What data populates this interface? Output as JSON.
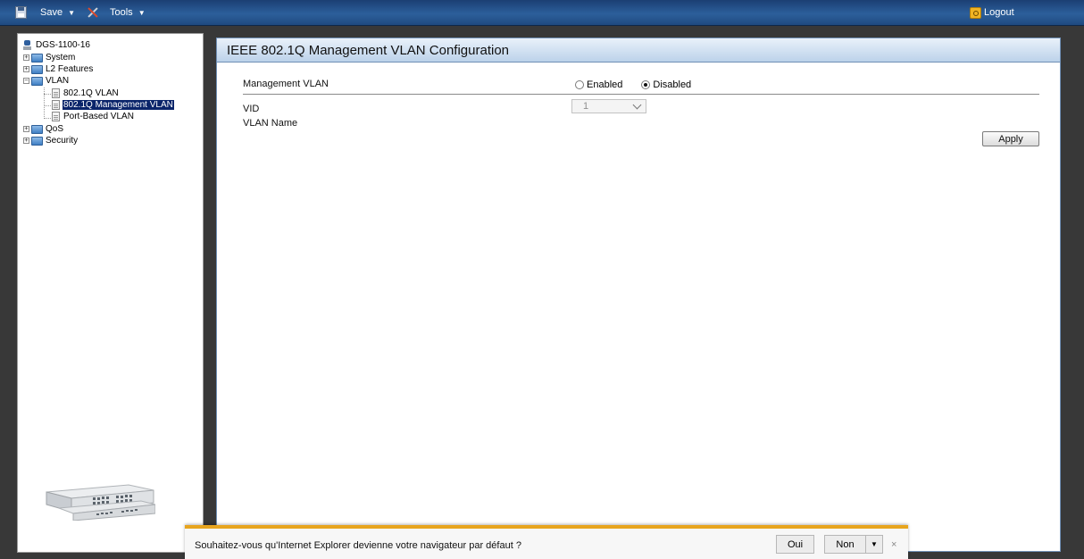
{
  "toolbar": {
    "save_label": "Save",
    "tools_label": "Tools",
    "logout_label": "Logout"
  },
  "tree": {
    "root": "DGS-1100-16",
    "items": {
      "system": "System",
      "l2_features": "L2 Features",
      "vlan": "VLAN",
      "vlan_8021q": "802.1Q VLAN",
      "vlan_8021q_mgmt": "802.1Q Management VLAN",
      "port_based_vlan": "Port-Based VLAN",
      "qos": "QoS",
      "security": "Security"
    },
    "selected": "802.1Q Management VLAN"
  },
  "content": {
    "title": "IEEE 802.1Q Management VLAN Configuration",
    "management_vlan_label": "Management VLAN",
    "enabled_label": "Enabled",
    "disabled_label": "Disabled",
    "selected_state": "Disabled",
    "vid_label": "VID",
    "vid_value": "1",
    "vlan_name_label": "VLAN Name",
    "apply_label": "Apply"
  },
  "ie_bar": {
    "message": "Souhaitez-vous qu'Internet Explorer devienne votre navigateur par défaut ?",
    "oui_label": "Oui",
    "non_label": "Non",
    "dropdown_glyph": "▼",
    "close_glyph": "×"
  },
  "colors": {
    "toolbar": "#2c5f9b",
    "selection": "#0a246a",
    "ie_accent": "#e8a51e"
  }
}
